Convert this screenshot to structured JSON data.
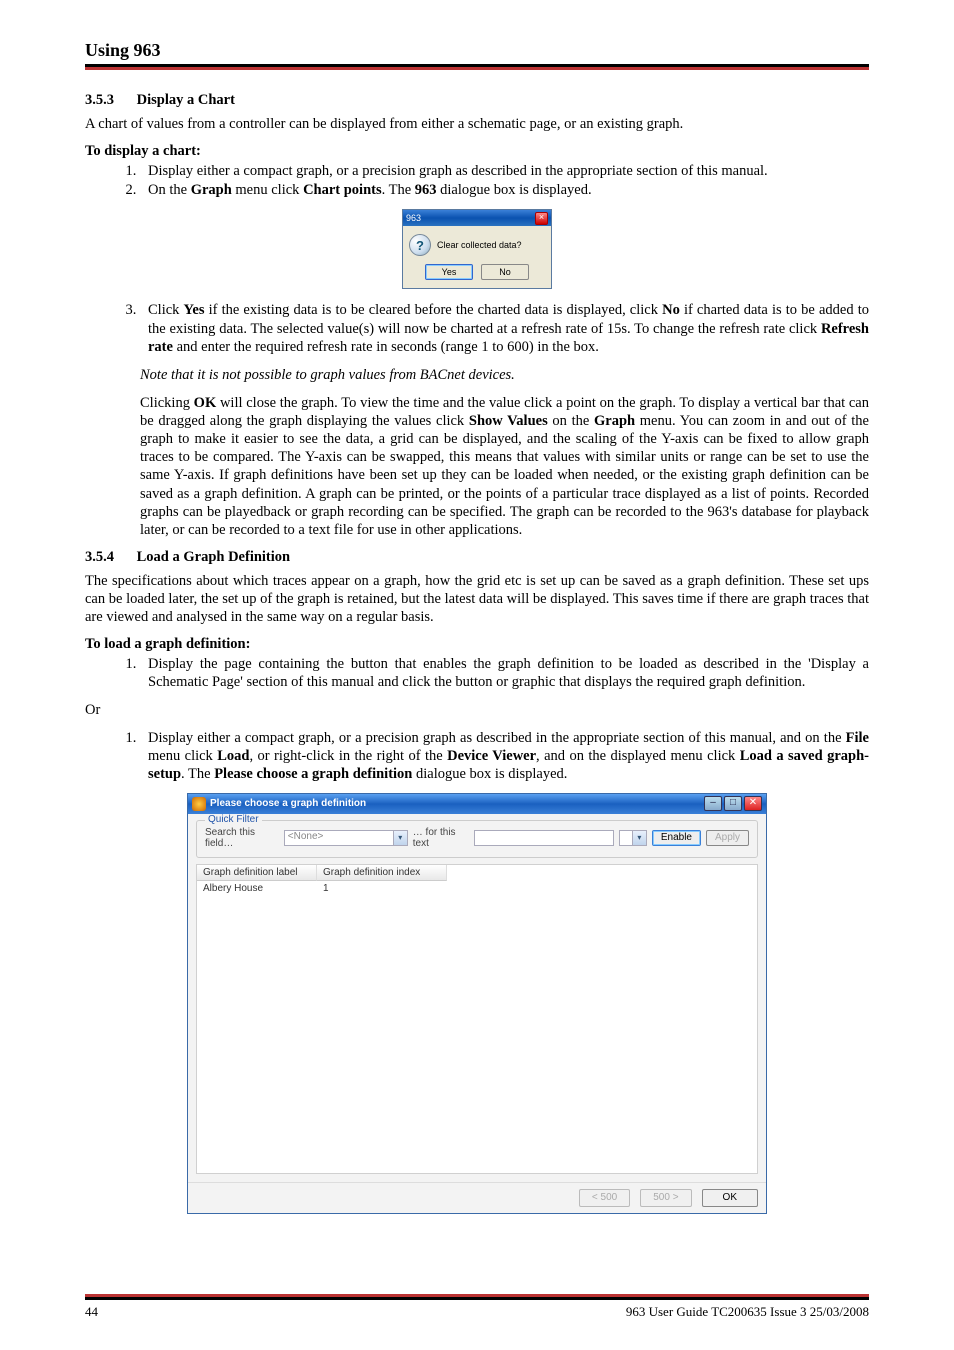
{
  "header": {
    "title": "Using 963"
  },
  "section353": {
    "number": "3.5.3",
    "title": "Display a Chart",
    "intro": "A chart of values from a controller can be displayed from either a schematic page, or an existing graph.",
    "lead": "To display a chart:",
    "step1": "Display either a compact graph, or a precision graph as described in the appropriate section of this manual.",
    "step2_pre": "On the ",
    "step2_b1": "Graph",
    "step2_mid1": " menu click ",
    "step2_b2": "Chart points",
    "step2_mid2": ". The ",
    "step2_b3": "963",
    "step2_post": " dialogue box is displayed.",
    "step3_p1": "Click ",
    "step3_b1": "Yes",
    "step3_p2": " if the existing data is to be cleared before the charted data is displayed, click ",
    "step3_b2": "No",
    "step3_p3": " if charted data is to be added to the existing data. The selected value(s) will now be charted at a refresh rate of 15s. To change the refresh rate click ",
    "step3_b3": "Refresh rate",
    "step3_p4": " and enter the required refresh rate in seconds (range 1 to 600) in the box.",
    "note": "Note that it is not possible to graph values from BACnet devices.",
    "para2_p1": "Clicking ",
    "para2_b1": "OK",
    "para2_p2": " will close the graph. To view the time and the value click a point on the graph. To display a vertical bar that can be dragged along the graph displaying the values click ",
    "para2_b2": "Show Values",
    "para2_p3": " on the ",
    "para2_b3": "Graph",
    "para2_p4": " menu. You can zoom in and out of the graph to make it easier to see the data, a grid can be displayed, and the scaling of the Y-axis can be fixed to allow graph traces to be compared. The Y-axis can be swapped, this means that values with similar units or range can be set to use the same Y-axis. If graph definitions have been set up they can be loaded when needed, or the existing graph definition can be saved as a graph definition. A graph can be printed, or the points of a particular trace displayed as a list of points. Recorded graphs can be playedback or graph recording can be specified. The graph can be recorded to the 963's database for playback later, or can be recorded to a text file for use in other applications."
  },
  "section354": {
    "number": "3.5.4",
    "title": "Load a Graph Definition",
    "intro": "The specifications about which traces appear on a graph, how the grid etc is set up can be saved as a graph definition. These set ups can be loaded later, the set up of the graph is retained, but the latest data will be displayed. This saves time if there are graph traces that are viewed and analysed in the same way on a regular basis.",
    "lead": "To load a graph definition:",
    "step1": "Display the page containing the button that enables the graph definition to be loaded as described in the 'Display a Schematic Page' section of this manual and click the button or graphic that displays the required graph definition.",
    "or": "Or",
    "step1b_p1": "Display either a compact graph, or a precision graph as described in the appropriate section of this manual, and on the ",
    "step1b_b1": "File",
    "step1b_p2": " menu click ",
    "step1b_b2": "Load",
    "step1b_p3": ", or right-click in the right of the ",
    "step1b_b3": "Device Viewer",
    "step1b_p4": ", and on the displayed menu click ",
    "step1b_b4": "Load a saved graph-setup",
    "step1b_p5": ". The ",
    "step1b_b5": "Please choose a graph definition",
    "step1b_p6": " dialogue box is displayed."
  },
  "dialog1": {
    "title": "963",
    "question_glyph": "?",
    "message": "Clear collected data?",
    "yes": "Yes",
    "no": "No"
  },
  "dialog2": {
    "title": "Please choose a graph definition",
    "quick_filter_legend": "Quick Filter",
    "search_label": "Search this field…",
    "search_select_value": "<None>",
    "for_text_label": "… for this text",
    "enable": "Enable",
    "apply": "Apply",
    "col1": "Graph definition label",
    "col2": "Graph definition index",
    "row1_label": "Albery House",
    "row1_index": "1",
    "prev": "< 500",
    "next": "500 >",
    "ok": "OK",
    "min_glyph": "–",
    "max_glyph": "□",
    "close_glyph": "✕",
    "dd_glyph": "▾"
  },
  "footer": {
    "page": "44",
    "doc": "963 User Guide TC200635 Issue 3 25/03/2008"
  }
}
